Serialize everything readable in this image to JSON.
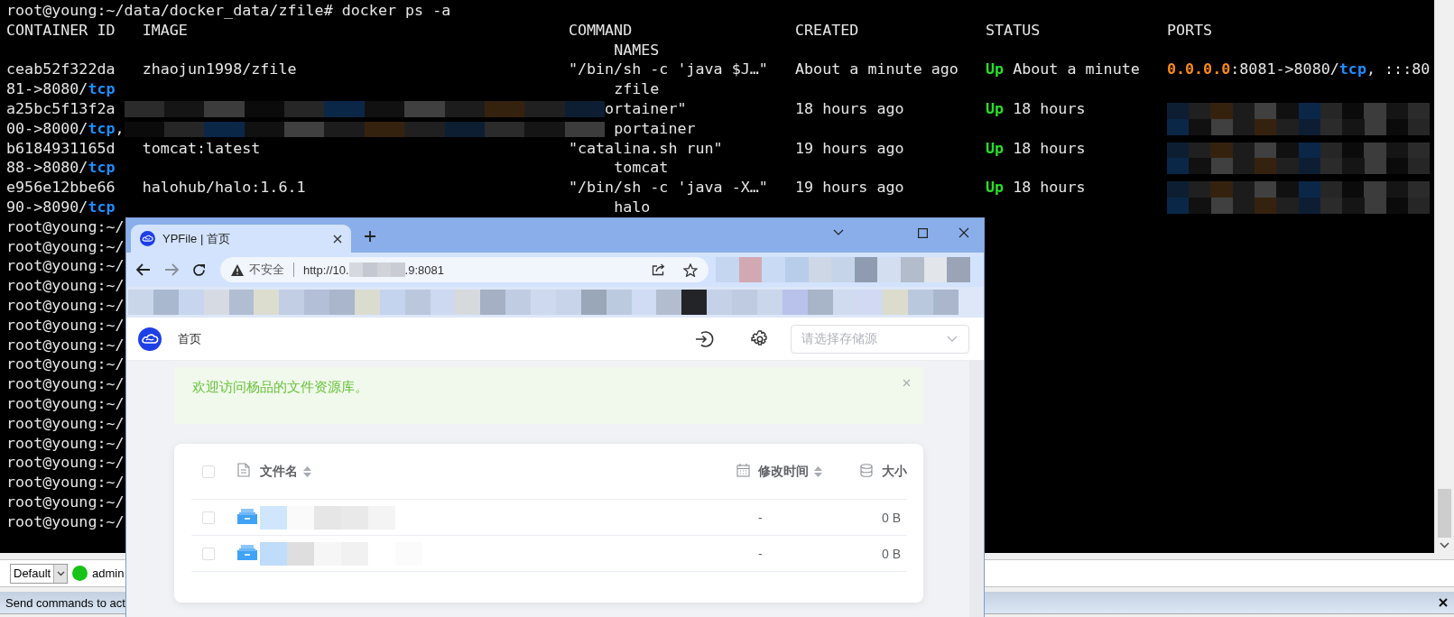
{
  "terminal": {
    "command_line": "root@young:~/data/docker_data/zfile# docker ps -a",
    "columns": [
      "CONTAINER ID",
      "IMAGE",
      "COMMAND",
      "CREATED",
      "STATUS",
      "PORTS"
    ],
    "names_header": "NAMES",
    "rows": [
      {
        "container_id": "ceab52f322da",
        "image": "zhaojun1998/zfile",
        "image_redacted": false,
        "command": "\"/bin/sh -c 'java $J…\"",
        "created": "About a minute ago",
        "state": "Up",
        "status": "About a minute",
        "ports": [
          {
            "text": "0.0.0.0",
            "kind": "ip"
          },
          {
            "text": ":8081->8080/",
            "kind": "text"
          },
          {
            "text": "tcp",
            "kind": "proto"
          },
          {
            "text": ", :::80",
            "kind": "text"
          }
        ],
        "ports_redacted": false,
        "ports_wrap": [
          {
            "text": "81->8080/",
            "kind": "text"
          },
          {
            "text": "tcp",
            "kind": "proto"
          }
        ],
        "wrap_redacted": false,
        "name": "zfile"
      },
      {
        "container_id": "a25bc5f13f2a",
        "image_redacted": true,
        "command": "ortainer\"",
        "created": "18 hours ago",
        "state": "Up",
        "status": "18 hours",
        "ports_redacted": true,
        "ports_wrap": [
          {
            "text": "00->8000/",
            "kind": "text"
          },
          {
            "text": "tcp",
            "kind": "proto"
          },
          {
            "text": ",",
            "kind": "text"
          }
        ],
        "wrap_redacted": true,
        "name": "portainer"
      },
      {
        "container_id": "b6184931165d",
        "image": "tomcat:latest",
        "image_redacted": false,
        "command": "\"catalina.sh run\"",
        "created": "19 hours ago",
        "state": "Up",
        "status": "18 hours",
        "ports_redacted": true,
        "ports_wrap": [
          {
            "text": "88->8080/",
            "kind": "text"
          },
          {
            "text": "tcp",
            "kind": "proto"
          }
        ],
        "wrap_redacted": false,
        "name": "tomcat"
      },
      {
        "container_id": "e956e12bbe66",
        "image": "halohub/halo:1.6.1",
        "image_redacted": false,
        "command": "\"/bin/sh -c 'java -X…\"",
        "created": "19 hours ago",
        "state": "Up",
        "status": "18 hours",
        "ports_redacted": true,
        "ports_wrap": [
          {
            "text": "90->8090/",
            "kind": "text"
          },
          {
            "text": "tcp",
            "kind": "proto"
          }
        ],
        "wrap_redacted": false,
        "name": "halo"
      }
    ],
    "prompts": [
      "root@young:~/",
      "root@young:~/",
      "root@young:~/",
      "root@young:~/",
      "root@young:~/",
      "root@young:~/",
      "root@young:~/",
      "root@young:~/",
      "root@young:~/",
      "root@young:~/",
      "root@young:~/",
      "root@young:~/",
      "root@young:~/",
      "root@young:~/",
      "root@young:~/",
      "root@young:~/"
    ]
  },
  "bottom_bar": {
    "session_select": {
      "value": "Default"
    },
    "user": {
      "name": "admin",
      "online": true
    },
    "send_bar": {
      "text": "Send commands to act"
    }
  },
  "browser": {
    "tabs": [
      {
        "title": "YPFile | 首页",
        "selected": true
      }
    ],
    "address": {
      "security": "不安全",
      "url_start": "http://10.",
      "url_end": ".9:8081"
    },
    "app": {
      "nav": "首页",
      "storage_select": {
        "placeholder": "请选择存储源"
      },
      "alert": "欢迎访问杨品的文件资源库。",
      "table": {
        "columns": [
          {
            "label": "文件名",
            "kind": "name"
          },
          {
            "label": "修改时间",
            "kind": "time"
          },
          {
            "label": "大小",
            "kind": "size"
          }
        ],
        "header_checked": false,
        "rows": [
          {
            "checked": false,
            "modified": "-",
            "size": "0 B"
          },
          {
            "checked": false,
            "modified": "-",
            "size": "0 B"
          }
        ]
      }
    }
  }
}
